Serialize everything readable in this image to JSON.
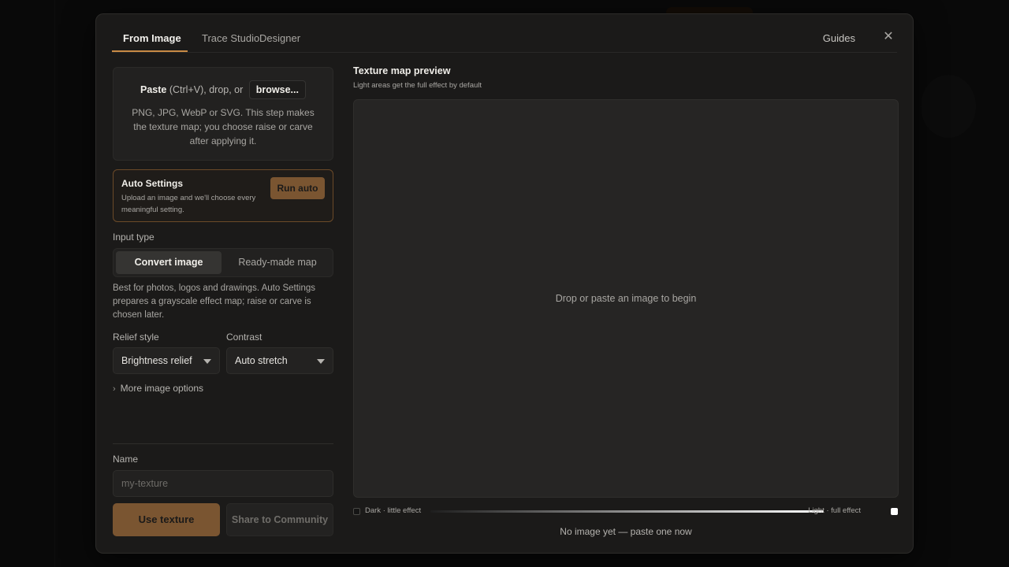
{
  "tabs": [
    {
      "label": "From Image"
    },
    {
      "label": "Trace Studio"
    },
    {
      "label": "Designer"
    }
  ],
  "header": {
    "guides_label": "Guides",
    "close_icon": "close-icon"
  },
  "dropzone": {
    "paste_bold": "Paste",
    "paste_rest": "(Ctrl+V), drop, or",
    "browse_label": "browse...",
    "description": "PNG, JPG, WebP or SVG. This step makes the texture map; you choose raise or carve after applying it."
  },
  "auto": {
    "title": "Auto Settings",
    "description": "Upload an image and we'll choose every meaningful setting.",
    "button": "Run auto",
    "accent": "#c88a45"
  },
  "input_type": {
    "label": "Input type",
    "options": [
      "Convert image",
      "Ready-made map"
    ],
    "selected": "Convert image",
    "description": "Best for photos, logos and drawings. Auto Settings prepares a grayscale effect map; raise or carve is chosen later."
  },
  "relief": {
    "label": "Relief style",
    "value": "Brightness relief"
  },
  "contrast": {
    "label": "Contrast",
    "value": "Auto stretch"
  },
  "more_options": "More image options",
  "name": {
    "label": "Name",
    "placeholder": "my-texture",
    "value": ""
  },
  "actions": {
    "use": "Use texture",
    "share": "Share to Community"
  },
  "preview": {
    "title": "Texture map preview",
    "subtitle": "Light areas get the full effect by default",
    "empty_message": "Drop or paste an image to begin",
    "legend_dark": "Dark · little effect",
    "legend_light": "Light · full effect",
    "status": "No image yet — paste one now"
  }
}
